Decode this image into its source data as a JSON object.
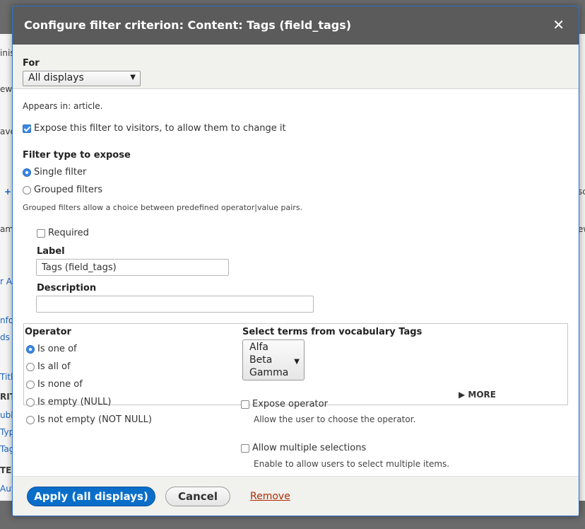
{
  "dialog": {
    "title": "Configure filter criterion: Content: Tags (field_tags)",
    "close_glyph": "✕"
  },
  "for_section": {
    "label": "For",
    "selected": "All displays"
  },
  "appears_in": "Appears in: article.",
  "expose_checkbox": {
    "label": "Expose this filter to visitors, to allow them to change it",
    "checked": true
  },
  "filter_type": {
    "heading": "Filter type to expose",
    "options": [
      {
        "label": "Single filter",
        "selected": true
      },
      {
        "label": "Grouped filters",
        "selected": false
      }
    ],
    "help": "Grouped filters allow a choice between predefined operator|value pairs."
  },
  "required": {
    "label": "Required",
    "checked": false
  },
  "label_field": {
    "label": "Label",
    "value": "Tags (field_tags)"
  },
  "description_field": {
    "label": "Description",
    "value": ""
  },
  "operator": {
    "heading": "Operator",
    "options": [
      {
        "label": "Is one of",
        "selected": true
      },
      {
        "label": "Is all of",
        "selected": false
      },
      {
        "label": "Is none of",
        "selected": false
      },
      {
        "label": "Is empty (NULL)",
        "selected": false
      },
      {
        "label": "Is not empty (NOT NULL)",
        "selected": false
      }
    ]
  },
  "terms": {
    "heading": "Select terms from vocabulary Tags",
    "options": [
      "Alfa",
      "Beta",
      "Gamma"
    ]
  },
  "more_toggle": "▶ MORE",
  "expose_operator": {
    "label": "Expose operator",
    "help": "Allow the user to choose the operator."
  },
  "multiple": {
    "label": "Allow multiple selections",
    "help": "Enable to allow users to select multiple items."
  },
  "footer": {
    "apply": "Apply (all displays)",
    "cancel": "Cancel",
    "remove": "Remove"
  },
  "background_fragments": [
    "inis",
    "ew",
    "ave",
    "+",
    "am",
    "r Au",
    "nfo",
    "ds",
    "Title",
    "RITE",
    "ubli",
    "Typ",
    "Tags",
    "TE",
    "Aut",
    "sc",
    "ew"
  ]
}
